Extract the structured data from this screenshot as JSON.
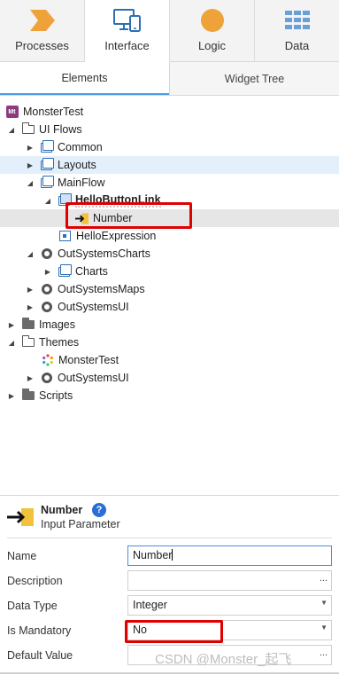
{
  "top_tabs": [
    {
      "label": "Processes",
      "icon": "processes-icon"
    },
    {
      "label": "Interface",
      "icon": "interface-icon"
    },
    {
      "label": "Logic",
      "icon": "logic-icon"
    },
    {
      "label": "Data",
      "icon": "data-icon"
    }
  ],
  "sub_tabs": {
    "elements": "Elements",
    "widget_tree": "Widget Tree"
  },
  "tree": {
    "root": "MonsterTest",
    "root_logo": "Mt",
    "ui_flows": "UI Flows",
    "common": "Common",
    "layouts": "Layouts",
    "mainflow": "MainFlow",
    "hello_button_link": "HelloButtonLink",
    "number": "Number",
    "hello_expression": "HelloExpression",
    "outsystems_charts": "OutSystemsCharts",
    "charts": "Charts",
    "outsystems_maps": "OutSystemsMaps",
    "outsystems_ui": "OutSystemsUI",
    "images": "Images",
    "themes": "Themes",
    "theme_monstertest": "MonsterTest",
    "theme_outsystemsui": "OutSystemsUI",
    "scripts": "Scripts"
  },
  "properties": {
    "title": "Number",
    "help": "?",
    "subtitle": "Input Parameter",
    "name_label": "Name",
    "name_value": "Number",
    "description_label": "Description",
    "description_value": "",
    "description_more": "...",
    "datatype_label": "Data Type",
    "datatype_value": "Integer",
    "mandatory_label": "Is Mandatory",
    "mandatory_value": "No",
    "default_label": "Default Value",
    "default_value": "",
    "default_more": "..."
  },
  "watermark": "CSDN @Monster_起飞",
  "colors": {
    "accent": "#4a9ee8",
    "highlight_box": "#e10000",
    "selected_row": "#e3effb",
    "focused_row": "#e6e6e6",
    "help": "#2a6ed6",
    "processes_icon": "#f0a23a",
    "interface_icon": "#2d6fb5",
    "logic_icon": "#f0a23a",
    "data_icon": "#6a9fd8"
  }
}
